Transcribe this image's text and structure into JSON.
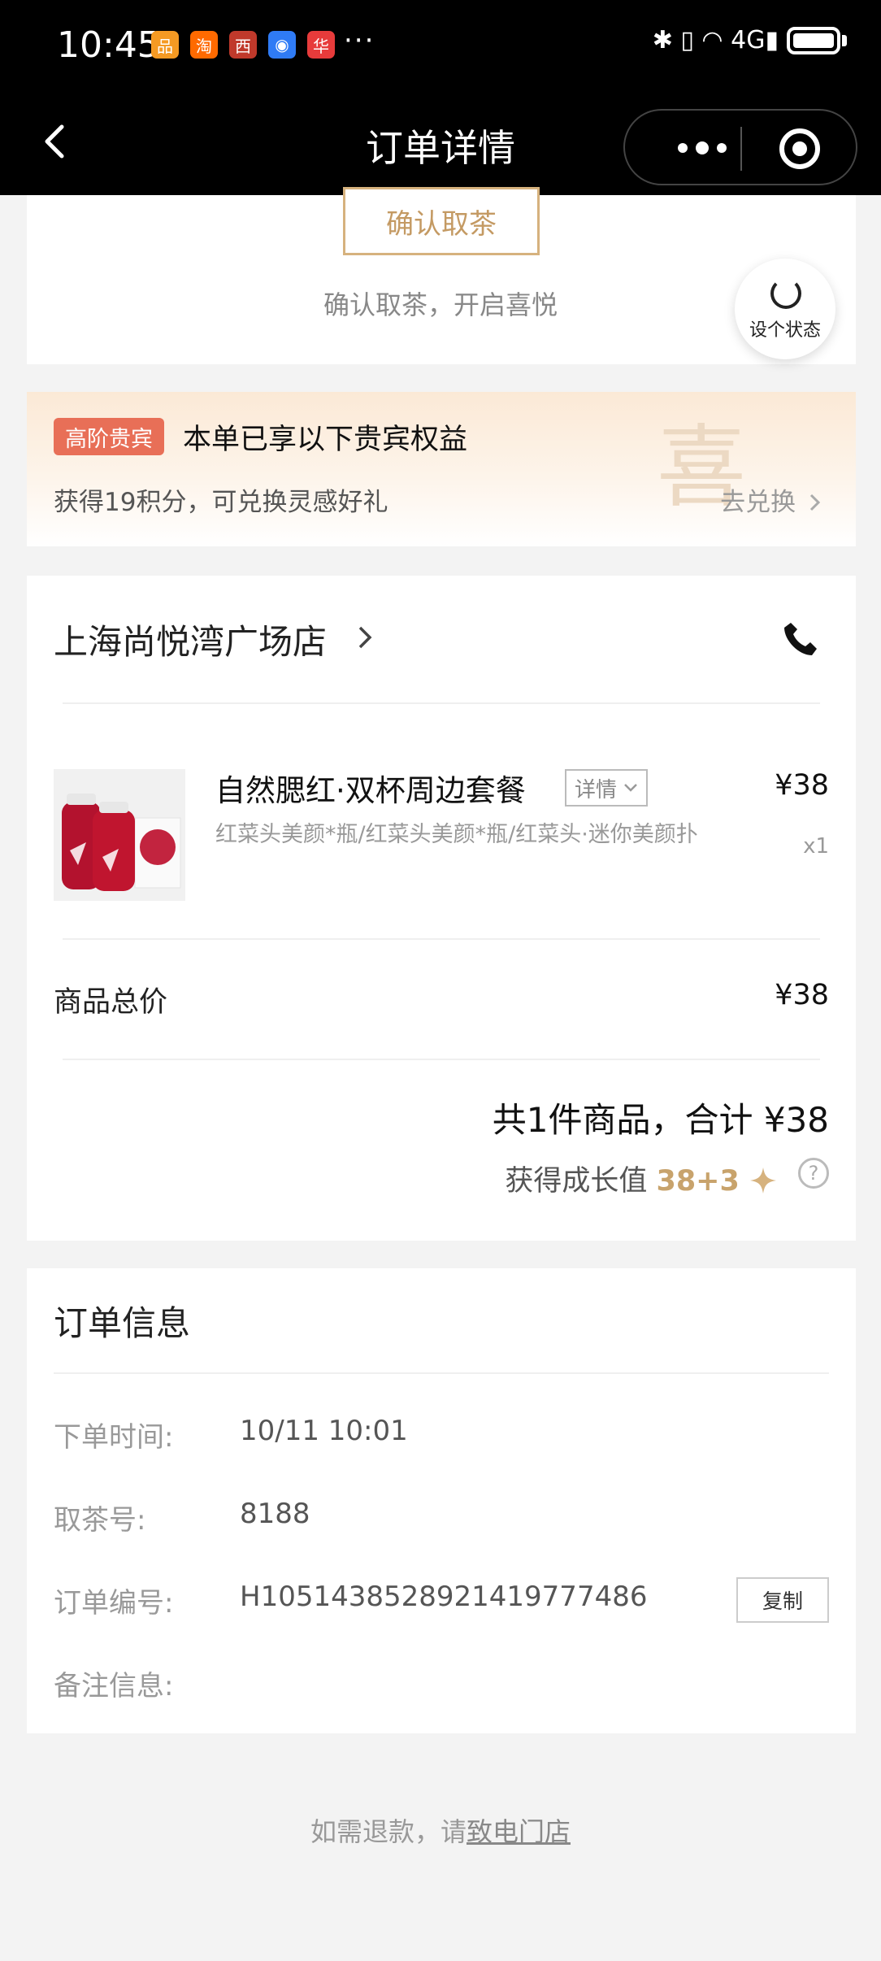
{
  "status_bar": {
    "time": "10:45",
    "apps": [
      {
        "icon": "app-icon-orange",
        "color": "#f59a23",
        "glyph": "品"
      },
      {
        "icon": "taobao-icon",
        "color": "#ff6a00",
        "glyph": "淘"
      },
      {
        "icon": "app-icon-red",
        "color": "#c0392b",
        "glyph": "西"
      },
      {
        "icon": "app-icon-blue",
        "color": "#2f7bf5",
        "glyph": "◉"
      },
      {
        "icon": "huawei-icon",
        "color": "#e73b3b",
        "glyph": "华"
      }
    ],
    "dots": "···",
    "right_indicators": "✱ ▯ ◠ 4G▮"
  },
  "nav": {
    "title": "订单详情"
  },
  "confirm": {
    "button_label": "确认取茶",
    "hint": "确认取茶，开启喜悦"
  },
  "status_fab": {
    "label": "设个状态"
  },
  "vip": {
    "badge": "高阶贵宾",
    "title": "本单已享以下贵宾权益",
    "desc": "获得19积分，可兑换灵感好礼",
    "link": "去兑换",
    "seal_char": "喜"
  },
  "store": {
    "name": "上海尚悦湾广场店",
    "product": {
      "name": "自然腮红·双杯周边套餐",
      "detail_tag": "详情",
      "price": "¥38",
      "sub": "红菜头美颜*瓶/红菜头美颜*瓶/红菜头·迷你美颜扑",
      "qty": "x1"
    },
    "total_label": "商品总价",
    "total_value": "¥38",
    "summary": "共1件商品，合计 ¥38",
    "growth_label": "获得成长值",
    "growth_value": "38+3",
    "help": "?"
  },
  "order": {
    "title": "订单信息",
    "rows": [
      {
        "label": "下单时间:",
        "value": "10/11 10:01"
      },
      {
        "label": "取茶号:",
        "value": "8188"
      },
      {
        "label": "订单编号:",
        "value": "H1051438528921419777486"
      },
      {
        "label": "备注信息:",
        "value": ""
      }
    ],
    "copy_label": "复制"
  },
  "refund": {
    "prefix": "如需退款，请",
    "link": "致电门店"
  }
}
